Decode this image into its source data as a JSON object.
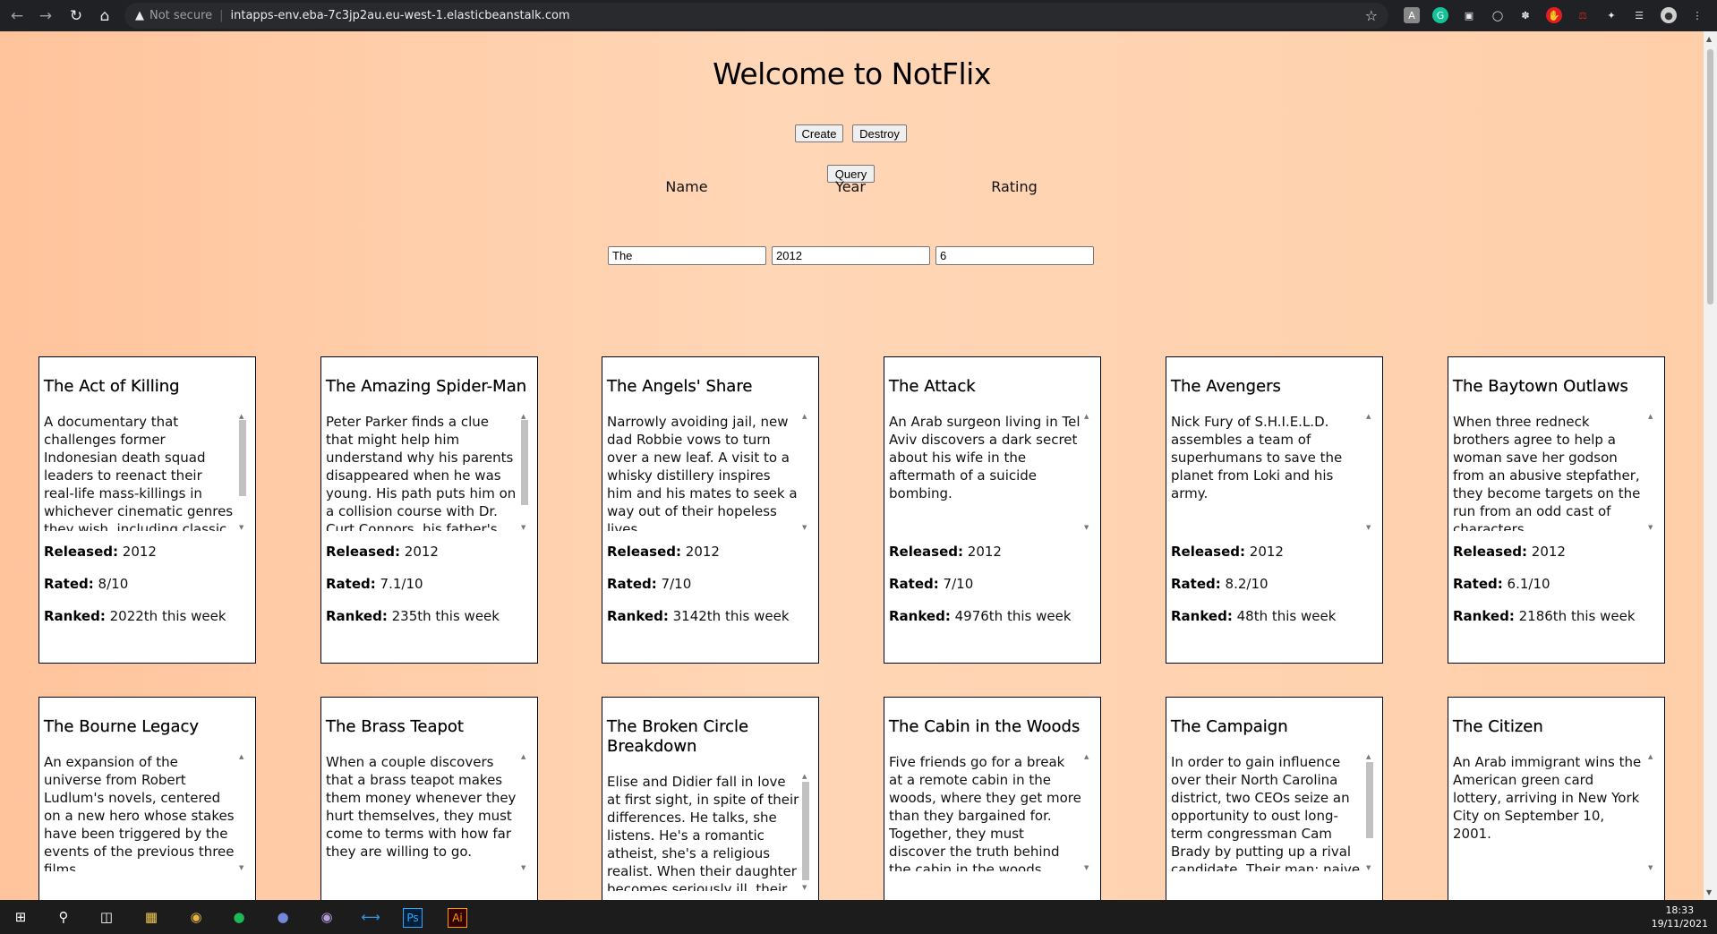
{
  "browser": {
    "security_label": "Not secure",
    "url": "intapps-env.eba-7c3jp2au.eu-west-1.elasticbeanstalk.com"
  },
  "page": {
    "title": "Welcome to NotFlix",
    "buttons": {
      "create": "Create",
      "destroy": "Destroy",
      "query": "Query"
    },
    "fields": {
      "name_label": "Name",
      "year_label": "Year",
      "rating_label": "Rating",
      "name_value": "The",
      "year_value": "2012",
      "rating_value": "6"
    }
  },
  "labels": {
    "released": "Released:",
    "rated": "Rated:",
    "ranked": "Ranked:"
  },
  "movies": [
    {
      "title": "The Act of Killing",
      "desc": "A documentary that challenges former Indonesian death squad leaders to reenact their real-life mass-killings in whichever cinematic genres they wish, including classic",
      "released": "2012",
      "rated": "8/10",
      "ranked": "2022th this week"
    },
    {
      "title": "The Amazing Spider-Man",
      "desc": "Peter Parker finds a clue that might help him understand why his parents disappeared when he was young. His path puts him on a collision course with Dr. Curt Connors, his father's",
      "released": "2012",
      "rated": "7.1/10",
      "ranked": "235th this week"
    },
    {
      "title": "The Angels' Share",
      "desc": "Narrowly avoiding jail, new dad Robbie vows to turn over a new leaf. A visit to a whisky distillery inspires him and his mates to seek a way out of their hopeless lives.",
      "released": "2012",
      "rated": "7/10",
      "ranked": "3142th this week"
    },
    {
      "title": "The Attack",
      "desc": "An Arab surgeon living in Tel Aviv discovers a dark secret about his wife in the aftermath of a suicide bombing.",
      "released": "2012",
      "rated": "7/10",
      "ranked": "4976th this week"
    },
    {
      "title": "The Avengers",
      "desc": "Nick Fury of S.H.I.E.L.D. assembles a team of superhumans to save the planet from Loki and his army.",
      "released": "2012",
      "rated": "8.2/10",
      "ranked": "48th this week"
    },
    {
      "title": "The Baytown Outlaws",
      "desc": "When three redneck brothers agree to help a woman save her godson from an abusive stepfather, they become targets on the run from an odd cast of characters.",
      "released": "2012",
      "rated": "6.1/10",
      "ranked": "2186th this week"
    },
    {
      "title": "The Bourne Legacy",
      "desc": "An expansion of the universe from Robert Ludlum's novels, centered on a new hero whose stakes have been triggered by the events of the previous three films."
    },
    {
      "title": "The Brass Teapot",
      "desc": "When a couple discovers that a brass teapot makes them money whenever they hurt themselves, they must come to terms with how far they are willing to go."
    },
    {
      "title": "The Broken Circle Breakdown",
      "desc": "Elise and Didier fall in love at first sight, in spite of their differences. He talks, she listens. He's a romantic atheist, she's a religious realist. When their daughter becomes seriously ill, their"
    },
    {
      "title": "The Cabin in the Woods",
      "desc": "Five friends go for a break at a remote cabin in the woods, where they get more than they bargained for. Together, they must discover the truth behind the cabin in the woods."
    },
    {
      "title": "The Campaign",
      "desc": "In order to gain influence over their North Carolina district, two CEOs seize an opportunity to oust long-term congressman Cam Brady by putting up a rival candidate. Their man: naive"
    },
    {
      "title": "The Citizen",
      "desc": "An Arab immigrant wins the American green card lottery, arriving in New York City on September 10, 2001."
    }
  ],
  "taskbar": {
    "time": "18:33",
    "date": "19/11/2021"
  }
}
